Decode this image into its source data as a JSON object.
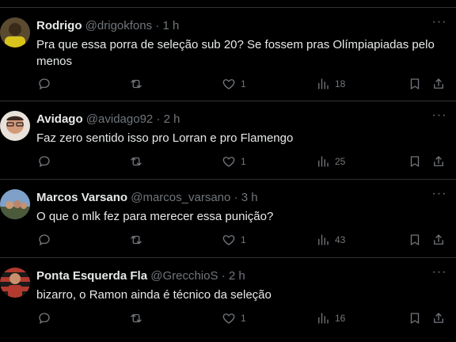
{
  "tweets": [
    {
      "name": "Rodrigo",
      "handle": "@drigokfons",
      "time": "1 h",
      "text": "Pra que essa porra de seleção sub 20? Se fossem pras Olímpiapiadas pelo menos",
      "likes": "1",
      "views": "18",
      "avatar_color": "#8a6a2c"
    },
    {
      "name": "Avidago",
      "handle": "@avidago92",
      "time": "2 h",
      "text": "Faz zero sentido isso pro Lorran e pro Flamengo",
      "likes": "1",
      "views": "25",
      "avatar_color": "#c48a6a"
    },
    {
      "name": "Marcos Varsano",
      "handle": "@marcos_varsano",
      "time": "3 h",
      "text": "O que o mlk fez para merecer essa punição?",
      "likes": "1",
      "views": "43",
      "avatar_color": "#6f86a8"
    },
    {
      "name": "Ponta Esquerda Fla",
      "handle": "@GrecchioS",
      "time": "2 h",
      "text": "bizarro, o Ramon ainda é técnico da seleção",
      "likes": "1",
      "views": "16",
      "avatar_color": "#b23a2e"
    }
  ],
  "separator_dot": "·",
  "more_label": "···"
}
